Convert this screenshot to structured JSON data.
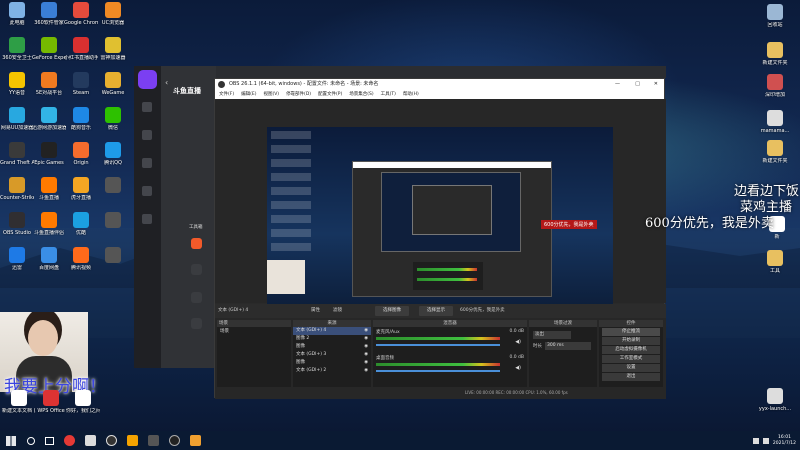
{
  "desktop_icons_left": [
    {
      "label": "此电脑",
      "color": "#7fb2e5"
    },
    {
      "label": "360软件管家",
      "color": "#3a7ed6"
    },
    {
      "label": "Google Chrome",
      "color": "#e54b3c"
    },
    {
      "label": "UC浏览器",
      "color": "#f08a24"
    },
    {
      "label": "360安全卫士",
      "color": "#2e9e46"
    },
    {
      "label": "GeForce Experience",
      "color": "#76b900"
    },
    {
      "label": "小红书直播助手",
      "color": "#d93030"
    },
    {
      "label": "雷神加速器",
      "color": "#e0c030"
    },
    {
      "label": "YY语音",
      "color": "#f5c400"
    },
    {
      "label": "5E对战平台",
      "color": "#f07a20"
    },
    {
      "label": "Steam",
      "color": "#233a5e"
    },
    {
      "label": "WeGame",
      "color": "#e8b030"
    },
    {
      "label": "网易UU加速器",
      "color": "#28a8e0"
    },
    {
      "label": "迅游网游加速器",
      "color": "#32b4e6"
    },
    {
      "label": "酷狗音乐",
      "color": "#1e88e5"
    },
    {
      "label": "微信",
      "color": "#2dc100"
    },
    {
      "label": "Grand Theft Auto V",
      "color": "#3a3a3a"
    },
    {
      "label": "Epic Games",
      "color": "#222"
    },
    {
      "label": "Origin",
      "color": "#f56c2d"
    },
    {
      "label": "腾讯QQ",
      "color": "#1e9be9"
    },
    {
      "label": "Counter-Strike Global Off...",
      "color": "#d89a28"
    },
    {
      "label": "斗鱼直播",
      "color": "#ff7a00"
    },
    {
      "label": "虎牙直播",
      "color": "#f5a623"
    },
    {
      "label": "",
      "color": "#555"
    },
    {
      "label": "OBS Studio",
      "color": "#302e31"
    },
    {
      "label": "斗鱼直播伴侣",
      "color": "#ff7a00"
    },
    {
      "label": "优酷",
      "color": "#1ba0e1"
    },
    {
      "label": "",
      "color": "#555"
    },
    {
      "label": "迅雷",
      "color": "#1e7ae6"
    },
    {
      "label": "百度网盘",
      "color": "#3a8ee6"
    },
    {
      "label": "腾讯视频",
      "color": "#ff6a1a"
    },
    {
      "label": "",
      "color": "#555"
    }
  ],
  "desktop_icons_right": [
    {
      "label": "回收站",
      "color": "#9bb7d4"
    },
    {
      "label": "新建文件夹",
      "color": "#e8c060"
    },
    {
      "label": "深印增加",
      "color": "#d05050"
    },
    {
      "label": "mamama...",
      "color": "#dddddd"
    },
    {
      "label": "新建文件夹",
      "color": "#e8c060"
    },
    {
      "label": "新",
      "color": "#ffffff"
    },
    {
      "label": "工具",
      "color": "#e8c060"
    },
    {
      "label": "yyx-launch...",
      "color": "#dddddd"
    }
  ],
  "bottom_icons": [
    {
      "label": "新建文本文档 (3)",
      "color": "#ffffff"
    },
    {
      "label": "WPS Office",
      "color": "#d33"
    },
    {
      "label": "你好，我们之间的对话...",
      "color": "#ffffff"
    }
  ],
  "overlay": {
    "line1": "边看边下饭",
    "line2": "菜鸡主播",
    "line3": "600分优先，我是外卖",
    "webcam_caption": "我要上分啊！"
  },
  "douyu": {
    "logo": "斗鱼直播",
    "nav_items": [
      "首页",
      "游戏",
      "视频",
      "聊天",
      "我的"
    ],
    "tool_label": "工具箱"
  },
  "obs": {
    "title": "OBS 26.1.1 (64-bit, windows) - 配置文件: 未命名 - 场景: 未命名",
    "menu": [
      "文件(F)",
      "编辑(E)",
      "视图(V)",
      "停靠部件(D)",
      "配置文件(P)",
      "场景集合(S)",
      "工具(T)",
      "帮助(H)"
    ],
    "source_label": "文本 (GDI+) 4",
    "toolbar": {
      "properties": "属性",
      "filter": "滤镜",
      "select_monitor": "选择图像",
      "select_display": "选择显示",
      "text_label": "600分优先，我是外卖"
    },
    "docks": {
      "scenes": "场景",
      "sources": "来源",
      "mixer": "混音器",
      "transitions": "场景过渡",
      "controls": "控件"
    },
    "scenes": [
      "场景"
    ],
    "sources": [
      "文本 (GDI+) 4",
      "图像 2",
      "图像",
      "文本 (GDI+) 3",
      "图像",
      "文本 (GDI+) 2"
    ],
    "mixer": [
      {
        "name": "麦克风/Aux",
        "db": "0.0 dB"
      },
      {
        "name": "桌面音频",
        "db": "0.0 dB"
      }
    ],
    "transition": {
      "type": "淡出",
      "duration_label": "时长",
      "duration": "300 ms"
    },
    "controls": [
      "停止推流",
      "开始录制",
      "启动虚拟摄像机",
      "工作室模式",
      "设置",
      "退出"
    ],
    "status": "LIVE: 00:00:00  REC: 00:00:00  CPU: 1.0%, 60.00 fps",
    "preview_badge": "600分优先，我是外卖"
  },
  "taskbar": {
    "time": "16:01",
    "date": "2021/7/12"
  }
}
